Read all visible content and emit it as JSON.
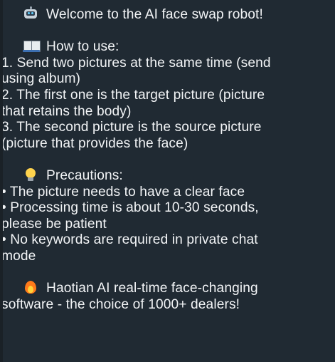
{
  "message": {
    "welcome": {
      "icon": "robot-icon",
      "text": "Welcome to the AI face swap robot!"
    },
    "how_to": {
      "icon": "book-icon",
      "title": "How to use:",
      "lines": [
        "1. Send two pictures at the same time (send",
        "using album)",
        "2. The first one is the target picture (picture",
        "that retains the body)",
        "3. The second picture is the source picture",
        "(picture that provides the face)"
      ]
    },
    "precautions": {
      "icon": "bulb-icon",
      "title": "Precautions:",
      "lines": [
        "• The picture needs to have a clear face",
        "• Processing time is about 10-30 seconds,",
        "please be patient",
        "• No keywords are required in private chat",
        "mode"
      ]
    },
    "promo": {
      "icon": "fire-icon",
      "lines": [
        "Haotian AI real-time face-changing",
        "software - the choice of 1000+ dealers!"
      ]
    }
  },
  "colors": {
    "bubble_background": "#202a33",
    "text": "#f2f4f6"
  }
}
